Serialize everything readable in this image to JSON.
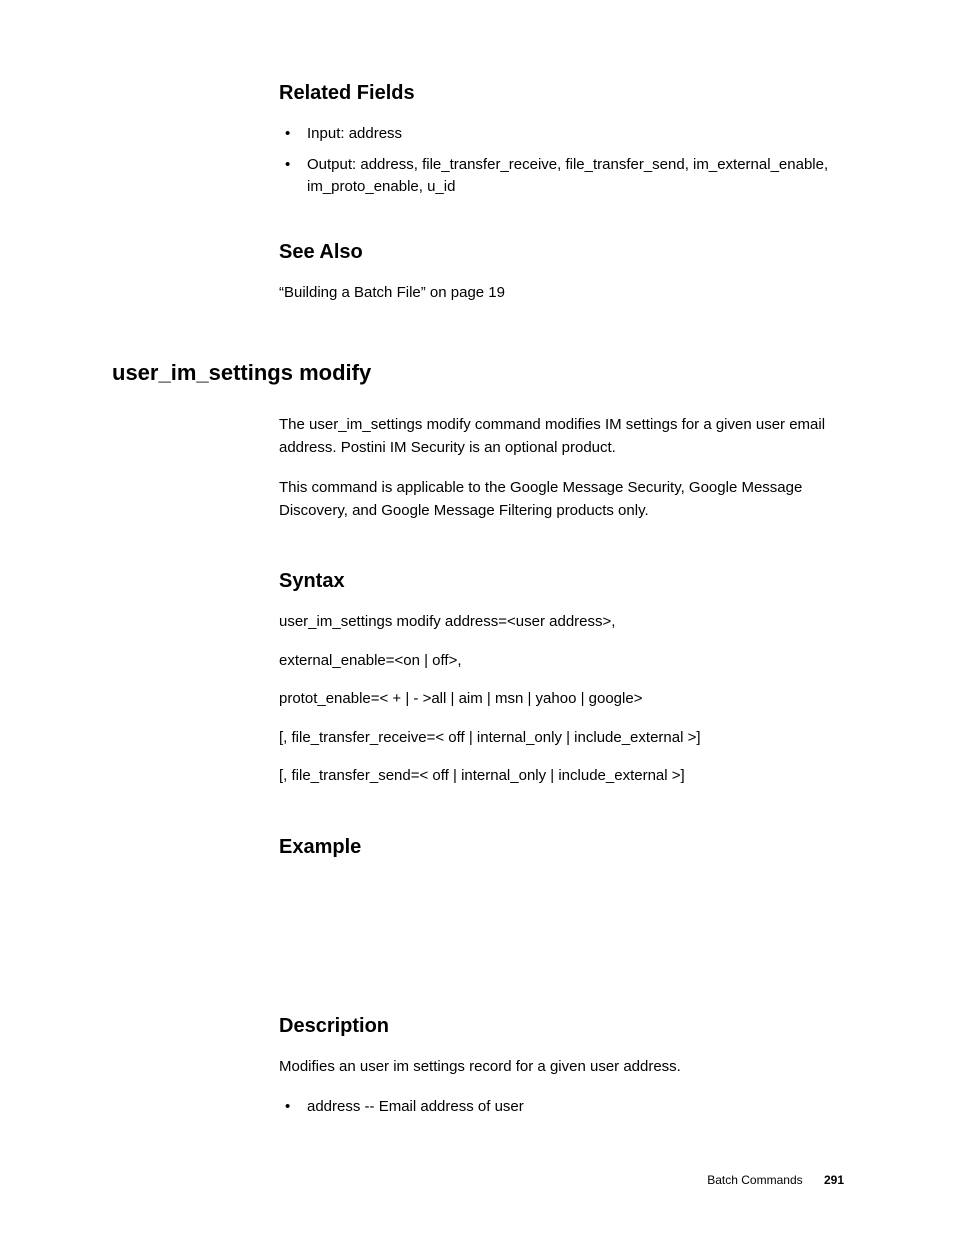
{
  "relatedFields": {
    "heading": "Related Fields",
    "items": [
      "Input: address",
      "Output: address, file_transfer_receive, file_transfer_send, im_external_enable, im_proto_enable, u_id"
    ]
  },
  "seeAlso": {
    "heading": "See Also",
    "text": "“Building a Batch File” on page 19"
  },
  "command": {
    "heading": "user_im_settings modify",
    "intro1": "The user_im_settings modify command modifies IM settings for a given user email address. Postini IM Security is an optional product.",
    "intro2": "This command is applicable to the Google Message Security, Google Message Discovery, and Google Message Filtering products only."
  },
  "syntax": {
    "heading": "Syntax",
    "lines": [
      "user_im_settings modify address=<user address>,",
      "external_enable=<on | off>,",
      "protot_enable=< + | - >all | aim | msn | yahoo | google>",
      "[, file_transfer_receive=< off | internal_only | include_external >]",
      "[, file_transfer_send=< off | internal_only | include_external >]"
    ]
  },
  "example": {
    "heading": "Example"
  },
  "description": {
    "heading": "Description",
    "text": "Modifies an user im settings record for a given user address.",
    "items": [
      "address -- Email address of user"
    ]
  },
  "footer": {
    "section": "Batch Commands",
    "page": "291"
  }
}
